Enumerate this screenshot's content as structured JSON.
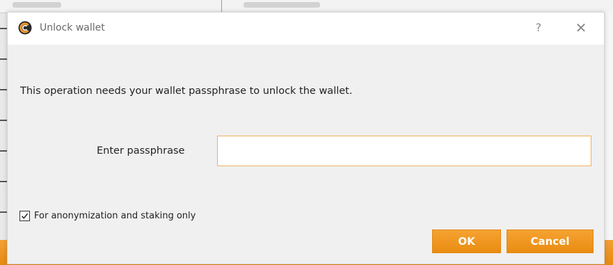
{
  "dialog": {
    "title": "Unlock wallet",
    "help_symbol": "?",
    "close_symbol": "✕",
    "app_icon": "wallet-logo-icon"
  },
  "message": "This operation needs your wallet passphrase to unlock the wallet.",
  "passphrase": {
    "label": "Enter passphrase",
    "value": ""
  },
  "anonymization": {
    "label": "For anonymization and staking only",
    "checked": true
  },
  "buttons": {
    "ok_label": "OK",
    "cancel_label": "Cancel"
  },
  "colors": {
    "accent": "#ee9420",
    "input_border": "#f0b15a",
    "dialog_bg": "#f0f0f0"
  }
}
